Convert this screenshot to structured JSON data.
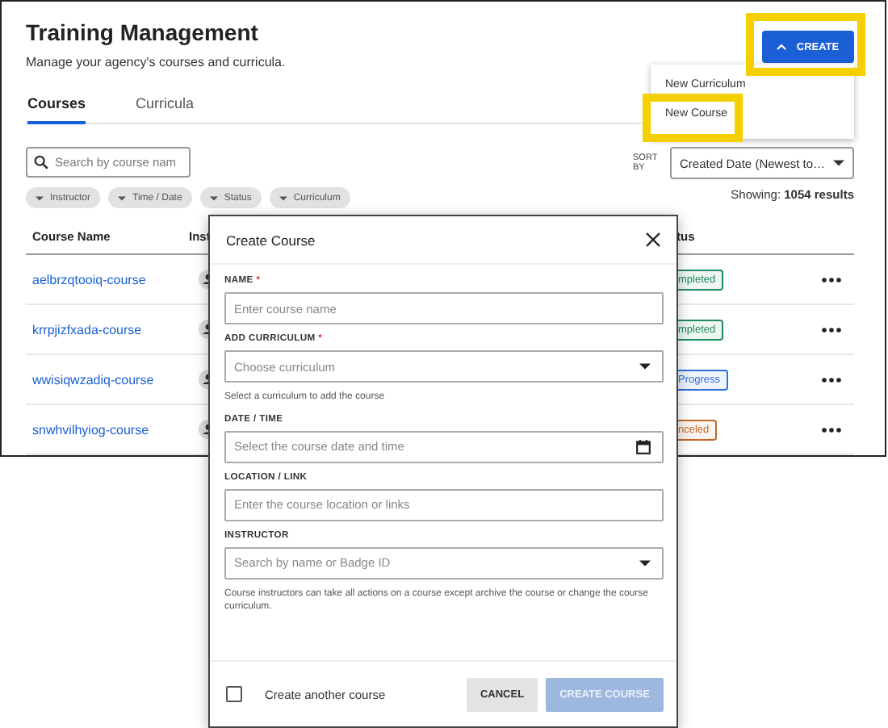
{
  "page": {
    "title": "Training Management",
    "subtitle": "Manage your agency's courses and curricula."
  },
  "create_button": {
    "label": "CREATE",
    "expanded": true,
    "highlighted": true
  },
  "create_menu": [
    {
      "label": "New Curriculum"
    },
    {
      "label": "New Course",
      "highlighted": true
    }
  ],
  "tabs": [
    {
      "label": "Courses",
      "selected": true
    },
    {
      "label": "Curricula",
      "selected": false
    }
  ],
  "search": {
    "placeholder": "Search by course nam"
  },
  "filters": [
    "Instructor",
    "Time / Date",
    "Status",
    "Curriculum"
  ],
  "sort": {
    "label": "SORT BY",
    "value": "Created Date (Newest to…"
  },
  "results": {
    "label": "Showing:",
    "count": "1054 results"
  },
  "table": {
    "columns": [
      "Course Name",
      "Inst",
      "tus"
    ],
    "rows": [
      {
        "name": "aelbrzqtooiq-course",
        "status": "mpleted",
        "color": "#1e8a5a"
      },
      {
        "name": "krrpjizfxada-course",
        "status": "mpleted",
        "color": "#1e8a5a"
      },
      {
        "name": "wwisiqwzadiq-course",
        "status": "Progress",
        "color": "#2f6fd8"
      },
      {
        "name": "snwhvilhyiog-course",
        "status": "nceled",
        "color": "#c0672a"
      }
    ]
  },
  "dialog": {
    "title": "Create Course",
    "fields": [
      {
        "kind": "text",
        "label": "NAME",
        "marker": "*",
        "placeholder": "Enter course name"
      },
      {
        "kind": "select",
        "label": "ADD CURRICULUM",
        "marker": "*",
        "placeholder": "Choose curriculum",
        "help": "Select a curriculum to add the course"
      },
      {
        "kind": "date",
        "label": "DATE / TIME",
        "placeholder": "Select the course date and time"
      },
      {
        "kind": "text",
        "label": "LOCATION / LINK",
        "placeholder": "Enter the course location or links"
      },
      {
        "kind": "select",
        "label": "INSTRUCTOR",
        "placeholder": "Search by name or Badge ID",
        "help": "Course instructors can take all actions on a course except archive the course or change the course curriculum."
      }
    ],
    "another": {
      "label": "Create another course",
      "checked": false
    },
    "cancel": {
      "label": "CANCEL",
      "disabled": false
    },
    "submit": {
      "label": "CREATE COURSE",
      "disabled": true
    }
  }
}
